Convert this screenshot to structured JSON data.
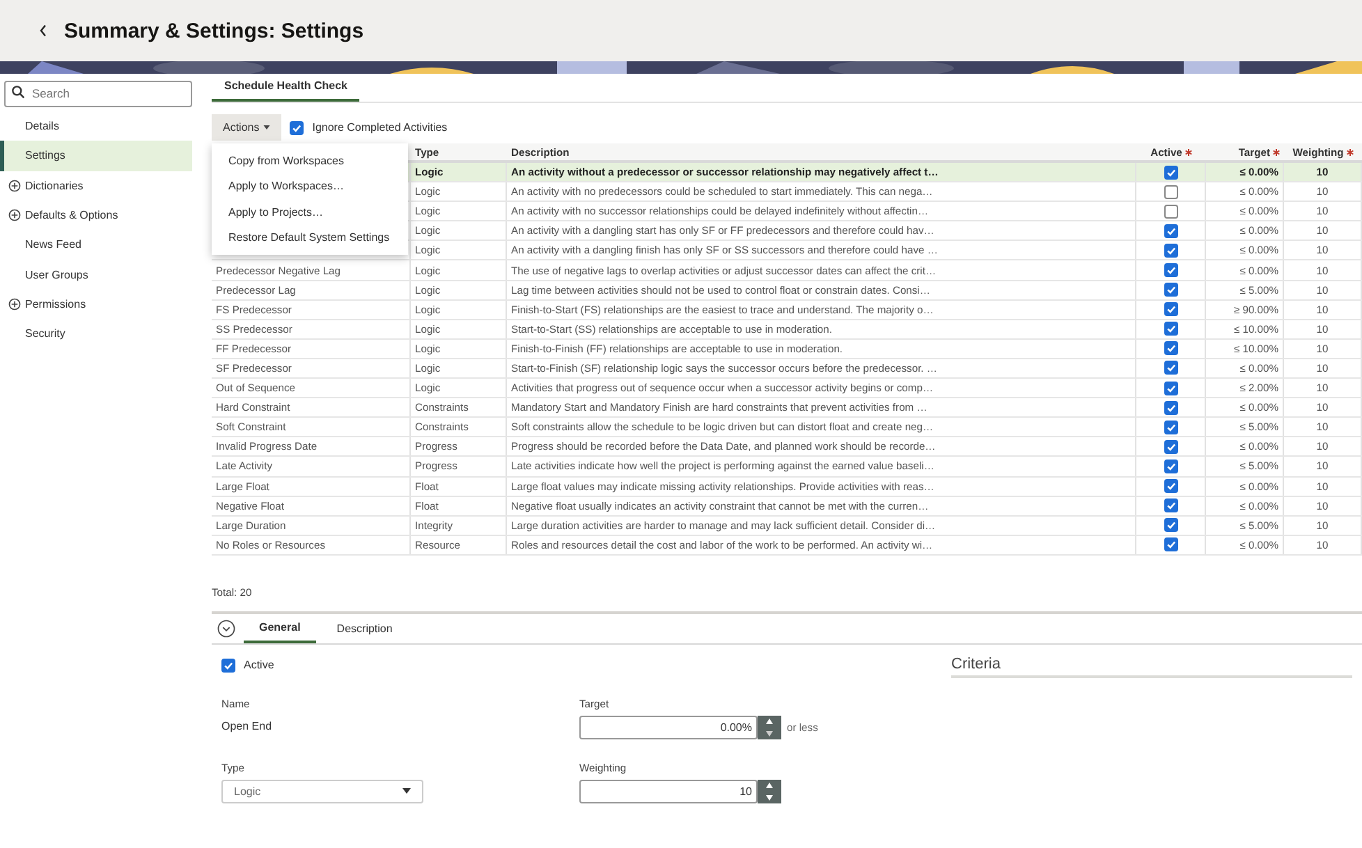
{
  "header": {
    "title": "Summary & Settings: Settings"
  },
  "banner": {
    "kind": "picture"
  },
  "sidebar": {
    "search": {
      "placeholder": "Search"
    },
    "items": [
      {
        "label": "Details",
        "selected": false,
        "expandable": false
      },
      {
        "label": "Settings",
        "selected": true,
        "expandable": false
      },
      {
        "label": "Dictionaries",
        "selected": false,
        "expandable": true
      },
      {
        "label": "Defaults & Options",
        "selected": false,
        "expandable": true
      },
      {
        "label": "News Feed",
        "selected": false,
        "expandable": false
      },
      {
        "label": "User Groups",
        "selected": false,
        "expandable": false
      },
      {
        "label": "Permissions",
        "selected": false,
        "expandable": true
      },
      {
        "label": "Security",
        "selected": false,
        "expandable": false
      }
    ]
  },
  "page_tabs": [
    {
      "label": "Schedule Health Check",
      "selected": true
    }
  ],
  "toolbar": {
    "actions": {
      "label": "Actions"
    },
    "ignore_completed": {
      "label": "Ignore Completed Activities",
      "checked": true
    }
  },
  "actions_menu": [
    "Copy from Workspaces",
    "Apply to Workspaces…",
    "Apply to Projects…",
    "Restore Default System Settings"
  ],
  "table": {
    "columns": [
      {
        "label": "Type",
        "required": false
      },
      {
        "label": "Description",
        "required": false
      },
      {
        "label": "Active",
        "required": true
      },
      {
        "label": "Target",
        "required": true
      },
      {
        "label": "Weighting",
        "required": true
      }
    ],
    "rows": [
      {
        "type": "Logic",
        "description": "An activity without a predecessor or successor relationship may negatively affect t…",
        "active": true,
        "target": "≤ 0.00%",
        "weighting": "10",
        "selected": true
      },
      {
        "type": "Logic",
        "description": "An activity with no predecessors could be scheduled to start immediately. This can nega…",
        "active": false,
        "target": "≤ 0.00%",
        "weighting": "10",
        "selected": false
      },
      {
        "type": "Logic",
        "description": "An activity with no successor relationships could be delayed indefinitely without affectin…",
        "active": false,
        "target": "≤ 0.00%",
        "weighting": "10",
        "selected": false
      },
      {
        "type": "Logic",
        "description": "An activity with a dangling start has only SF or FF predecessors and therefore could hav…",
        "active": true,
        "target": "≤ 0.00%",
        "weighting": "10",
        "selected": false
      },
      {
        "type": "Logic",
        "description": "An activity with a dangling finish has only SF or SS successors and therefore could have …",
        "active": true,
        "target": "≤ 0.00%",
        "weighting": "10",
        "selected": false
      },
      {
        "name": "Predecessor Negative Lag",
        "type": "Logic",
        "description": "The use of negative lags to overlap activities or adjust successor dates can affect the crit…",
        "active": true,
        "target": "≤ 0.00%",
        "weighting": "10",
        "selected": false
      },
      {
        "name": "Predecessor Lag",
        "type": "Logic",
        "description": "Lag time between activities should not be used to control float or constrain dates. Consi…",
        "active": true,
        "target": "≤ 5.00%",
        "weighting": "10",
        "selected": false
      },
      {
        "name": "FS Predecessor",
        "type": "Logic",
        "description": "Finish-to-Start (FS) relationships are the easiest to trace and understand. The majority o…",
        "active": true,
        "target": "≥ 90.00%",
        "weighting": "10",
        "selected": false
      },
      {
        "name": "SS Predecessor",
        "type": "Logic",
        "description": "Start-to-Start (SS) relationships are acceptable to use in moderation.",
        "active": true,
        "target": "≤ 10.00%",
        "weighting": "10",
        "selected": false
      },
      {
        "name": "FF Predecessor",
        "type": "Logic",
        "description": "Finish-to-Finish (FF) relationships are acceptable to use in moderation.",
        "active": true,
        "target": "≤ 10.00%",
        "weighting": "10",
        "selected": false
      },
      {
        "name": "SF Predecessor",
        "type": "Logic",
        "description": "Start-to-Finish (SF) relationship logic says the successor occurs before the predecessor. …",
        "active": true,
        "target": "≤ 0.00%",
        "weighting": "10",
        "selected": false
      },
      {
        "name": "Out of Sequence",
        "type": "Logic",
        "description": "Activities that progress out of sequence occur when a successor activity begins or comp…",
        "active": true,
        "target": "≤ 2.00%",
        "weighting": "10",
        "selected": false
      },
      {
        "name": "Hard Constraint",
        "type": "Constraints",
        "description": "Mandatory Start and Mandatory Finish are hard constraints that prevent activities from …",
        "active": true,
        "target": "≤ 0.00%",
        "weighting": "10",
        "selected": false
      },
      {
        "name": "Soft Constraint",
        "type": "Constraints",
        "description": "Soft constraints allow the schedule to be logic driven but can distort float and create neg…",
        "active": true,
        "target": "≤ 5.00%",
        "weighting": "10",
        "selected": false
      },
      {
        "name": "Invalid Progress Date",
        "type": "Progress",
        "description": "Progress should be recorded before the Data Date, and planned work should be recorde…",
        "active": true,
        "target": "≤ 0.00%",
        "weighting": "10",
        "selected": false
      },
      {
        "name": "Late Activity",
        "type": "Progress",
        "description": "Late activities indicate how well the project is performing against the earned value baseli…",
        "active": true,
        "target": "≤ 5.00%",
        "weighting": "10",
        "selected": false
      },
      {
        "name": "Large Float",
        "type": "Float",
        "description": "Large float values may indicate missing activity relationships. Provide activities with reas…",
        "active": true,
        "target": "≤ 0.00%",
        "weighting": "10",
        "selected": false
      },
      {
        "name": "Negative Float",
        "type": "Float",
        "description": "Negative float usually indicates an activity constraint that cannot be met with the curren…",
        "active": true,
        "target": "≤ 0.00%",
        "weighting": "10",
        "selected": false
      },
      {
        "name": "Large Duration",
        "type": "Integrity",
        "description": "Large duration activities are harder to manage and may lack sufficient detail. Consider di…",
        "active": true,
        "target": "≤ 5.00%",
        "weighting": "10",
        "selected": false
      },
      {
        "name": "No Roles or Resources",
        "type": "Resource",
        "description": "Roles and resources detail the cost and labor of the work to be performed. An activity wi…",
        "active": true,
        "target": "≤ 0.00%",
        "weighting": "10",
        "selected": false
      }
    ]
  },
  "total": "Total: 20",
  "detail": {
    "tabs": [
      {
        "label": "General",
        "selected": true
      },
      {
        "label": "Description",
        "selected": false
      }
    ],
    "active": {
      "label": "Active",
      "checked": true
    },
    "name": {
      "label": "Name",
      "value": "Open End"
    },
    "type": {
      "label": "Type",
      "value": "Logic"
    },
    "target": {
      "label": "Target",
      "value": "0.00%",
      "suffix": "or less"
    },
    "weighting": {
      "label": "Weighting",
      "value": "10"
    },
    "criteria": {
      "title": "Criteria"
    }
  }
}
